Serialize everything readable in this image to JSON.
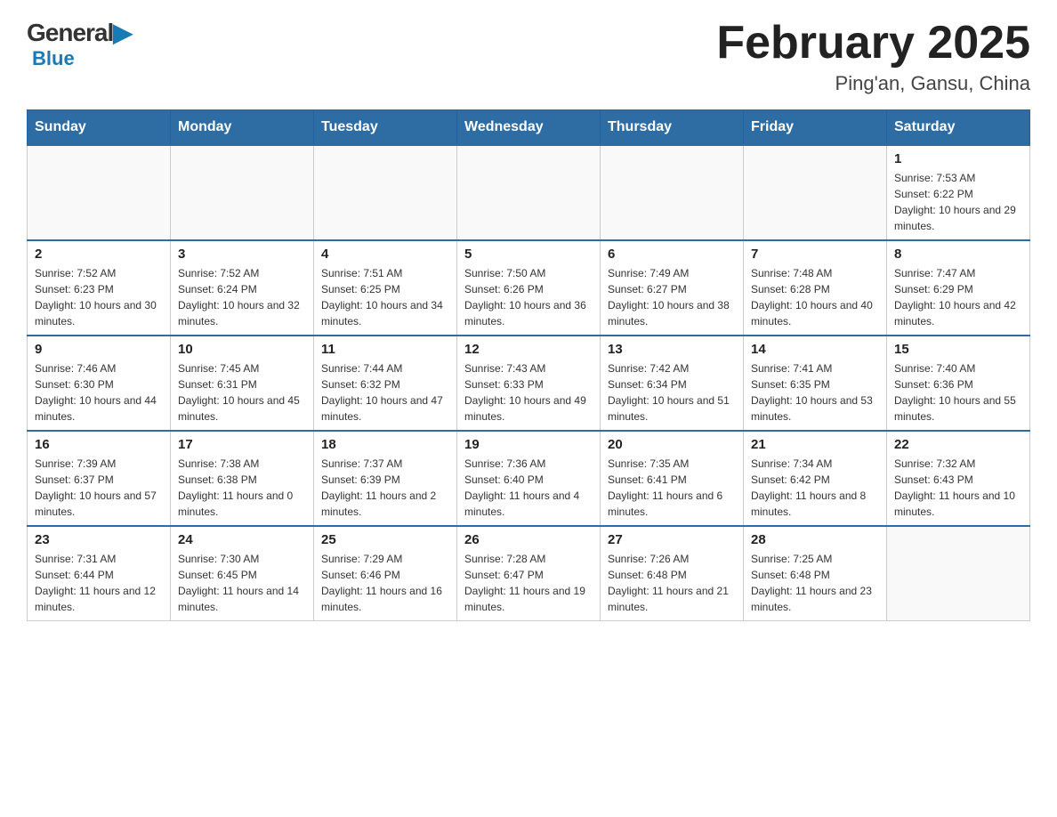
{
  "logo": {
    "general": "General",
    "blue_arrow": "▶",
    "blue": "Blue"
  },
  "title": {
    "month_year": "February 2025",
    "location": "Ping'an, Gansu, China"
  },
  "weekdays": [
    "Sunday",
    "Monday",
    "Tuesday",
    "Wednesday",
    "Thursday",
    "Friday",
    "Saturday"
  ],
  "weeks": [
    [
      {
        "day": "",
        "sunrise": "",
        "sunset": "",
        "daylight": "",
        "empty": true
      },
      {
        "day": "",
        "sunrise": "",
        "sunset": "",
        "daylight": "",
        "empty": true
      },
      {
        "day": "",
        "sunrise": "",
        "sunset": "",
        "daylight": "",
        "empty": true
      },
      {
        "day": "",
        "sunrise": "",
        "sunset": "",
        "daylight": "",
        "empty": true
      },
      {
        "day": "",
        "sunrise": "",
        "sunset": "",
        "daylight": "",
        "empty": true
      },
      {
        "day": "",
        "sunrise": "",
        "sunset": "",
        "daylight": "",
        "empty": true
      },
      {
        "day": "1",
        "sunrise": "Sunrise: 7:53 AM",
        "sunset": "Sunset: 6:22 PM",
        "daylight": "Daylight: 10 hours and 29 minutes.",
        "empty": false
      }
    ],
    [
      {
        "day": "2",
        "sunrise": "Sunrise: 7:52 AM",
        "sunset": "Sunset: 6:23 PM",
        "daylight": "Daylight: 10 hours and 30 minutes.",
        "empty": false
      },
      {
        "day": "3",
        "sunrise": "Sunrise: 7:52 AM",
        "sunset": "Sunset: 6:24 PM",
        "daylight": "Daylight: 10 hours and 32 minutes.",
        "empty": false
      },
      {
        "day": "4",
        "sunrise": "Sunrise: 7:51 AM",
        "sunset": "Sunset: 6:25 PM",
        "daylight": "Daylight: 10 hours and 34 minutes.",
        "empty": false
      },
      {
        "day": "5",
        "sunrise": "Sunrise: 7:50 AM",
        "sunset": "Sunset: 6:26 PM",
        "daylight": "Daylight: 10 hours and 36 minutes.",
        "empty": false
      },
      {
        "day": "6",
        "sunrise": "Sunrise: 7:49 AM",
        "sunset": "Sunset: 6:27 PM",
        "daylight": "Daylight: 10 hours and 38 minutes.",
        "empty": false
      },
      {
        "day": "7",
        "sunrise": "Sunrise: 7:48 AM",
        "sunset": "Sunset: 6:28 PM",
        "daylight": "Daylight: 10 hours and 40 minutes.",
        "empty": false
      },
      {
        "day": "8",
        "sunrise": "Sunrise: 7:47 AM",
        "sunset": "Sunset: 6:29 PM",
        "daylight": "Daylight: 10 hours and 42 minutes.",
        "empty": false
      }
    ],
    [
      {
        "day": "9",
        "sunrise": "Sunrise: 7:46 AM",
        "sunset": "Sunset: 6:30 PM",
        "daylight": "Daylight: 10 hours and 44 minutes.",
        "empty": false
      },
      {
        "day": "10",
        "sunrise": "Sunrise: 7:45 AM",
        "sunset": "Sunset: 6:31 PM",
        "daylight": "Daylight: 10 hours and 45 minutes.",
        "empty": false
      },
      {
        "day": "11",
        "sunrise": "Sunrise: 7:44 AM",
        "sunset": "Sunset: 6:32 PM",
        "daylight": "Daylight: 10 hours and 47 minutes.",
        "empty": false
      },
      {
        "day": "12",
        "sunrise": "Sunrise: 7:43 AM",
        "sunset": "Sunset: 6:33 PM",
        "daylight": "Daylight: 10 hours and 49 minutes.",
        "empty": false
      },
      {
        "day": "13",
        "sunrise": "Sunrise: 7:42 AM",
        "sunset": "Sunset: 6:34 PM",
        "daylight": "Daylight: 10 hours and 51 minutes.",
        "empty": false
      },
      {
        "day": "14",
        "sunrise": "Sunrise: 7:41 AM",
        "sunset": "Sunset: 6:35 PM",
        "daylight": "Daylight: 10 hours and 53 minutes.",
        "empty": false
      },
      {
        "day": "15",
        "sunrise": "Sunrise: 7:40 AM",
        "sunset": "Sunset: 6:36 PM",
        "daylight": "Daylight: 10 hours and 55 minutes.",
        "empty": false
      }
    ],
    [
      {
        "day": "16",
        "sunrise": "Sunrise: 7:39 AM",
        "sunset": "Sunset: 6:37 PM",
        "daylight": "Daylight: 10 hours and 57 minutes.",
        "empty": false
      },
      {
        "day": "17",
        "sunrise": "Sunrise: 7:38 AM",
        "sunset": "Sunset: 6:38 PM",
        "daylight": "Daylight: 11 hours and 0 minutes.",
        "empty": false
      },
      {
        "day": "18",
        "sunrise": "Sunrise: 7:37 AM",
        "sunset": "Sunset: 6:39 PM",
        "daylight": "Daylight: 11 hours and 2 minutes.",
        "empty": false
      },
      {
        "day": "19",
        "sunrise": "Sunrise: 7:36 AM",
        "sunset": "Sunset: 6:40 PM",
        "daylight": "Daylight: 11 hours and 4 minutes.",
        "empty": false
      },
      {
        "day": "20",
        "sunrise": "Sunrise: 7:35 AM",
        "sunset": "Sunset: 6:41 PM",
        "daylight": "Daylight: 11 hours and 6 minutes.",
        "empty": false
      },
      {
        "day": "21",
        "sunrise": "Sunrise: 7:34 AM",
        "sunset": "Sunset: 6:42 PM",
        "daylight": "Daylight: 11 hours and 8 minutes.",
        "empty": false
      },
      {
        "day": "22",
        "sunrise": "Sunrise: 7:32 AM",
        "sunset": "Sunset: 6:43 PM",
        "daylight": "Daylight: 11 hours and 10 minutes.",
        "empty": false
      }
    ],
    [
      {
        "day": "23",
        "sunrise": "Sunrise: 7:31 AM",
        "sunset": "Sunset: 6:44 PM",
        "daylight": "Daylight: 11 hours and 12 minutes.",
        "empty": false
      },
      {
        "day": "24",
        "sunrise": "Sunrise: 7:30 AM",
        "sunset": "Sunset: 6:45 PM",
        "daylight": "Daylight: 11 hours and 14 minutes.",
        "empty": false
      },
      {
        "day": "25",
        "sunrise": "Sunrise: 7:29 AM",
        "sunset": "Sunset: 6:46 PM",
        "daylight": "Daylight: 11 hours and 16 minutes.",
        "empty": false
      },
      {
        "day": "26",
        "sunrise": "Sunrise: 7:28 AM",
        "sunset": "Sunset: 6:47 PM",
        "daylight": "Daylight: 11 hours and 19 minutes.",
        "empty": false
      },
      {
        "day": "27",
        "sunrise": "Sunrise: 7:26 AM",
        "sunset": "Sunset: 6:48 PM",
        "daylight": "Daylight: 11 hours and 21 minutes.",
        "empty": false
      },
      {
        "day": "28",
        "sunrise": "Sunrise: 7:25 AM",
        "sunset": "Sunset: 6:48 PM",
        "daylight": "Daylight: 11 hours and 23 minutes.",
        "empty": false
      },
      {
        "day": "",
        "sunrise": "",
        "sunset": "",
        "daylight": "",
        "empty": true
      }
    ]
  ]
}
